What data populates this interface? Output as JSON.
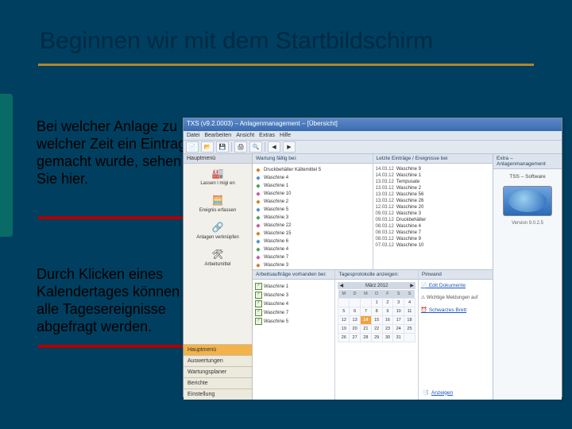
{
  "slide": {
    "title": "Beginnen wir mit dem Startbildschirm",
    "para1": "Bei welcher Anlage zu welcher Zeit ein Eintrag gemacht wurde, sehen Sie hier.",
    "para2": "Durch Klicken eines Kalendertages können alle Tagesereignisse abgefragt werden."
  },
  "window": {
    "title": "TXS (v9.2.0003) – Anlagenmanagement – [Übersicht]",
    "menubar": [
      "Datei",
      "Bearbeiten",
      "Ansicht",
      "Extras",
      "Hilfe"
    ]
  },
  "sidebar": {
    "header": "Hauptmenü",
    "items": [
      {
        "icon": "🏭",
        "label": "Lassen l migi en"
      },
      {
        "icon": "🧮",
        "label": "Ereignis erfassen"
      },
      {
        "icon": "🔗",
        "label": "Anlagen verknüpfen"
      },
      {
        "icon": "🛠",
        "label": "Arbeitsmittel"
      }
    ],
    "tabs": [
      "Hauptmenü",
      "Auswertungen",
      "Wartungsplaner",
      "Berichte",
      "Einstellung"
    ]
  },
  "panels": {
    "wartung": {
      "title": "Wartung fällig bei:",
      "items": [
        {
          "iconColor": "#d08030",
          "label": "Druckbehälter Kältemittel 5"
        },
        {
          "iconColor": "#5a8acc",
          "label": "Waschine 4"
        },
        {
          "iconColor": "#4aa050",
          "label": "Waschine 1"
        },
        {
          "iconColor": "#c85a9a",
          "label": "Waschine 10"
        },
        {
          "iconColor": "#d08030",
          "label": "Waschine 2"
        },
        {
          "iconColor": "#5a8acc",
          "label": "Waschine 5"
        },
        {
          "iconColor": "#4aa050",
          "label": "Waschine 3"
        },
        {
          "iconColor": "#c85a9a",
          "label": "Waschine 22"
        },
        {
          "iconColor": "#d08030",
          "label": "Waschine 15"
        },
        {
          "iconColor": "#5a8acc",
          "label": "Waschine 6"
        },
        {
          "iconColor": "#4aa050",
          "label": "Waschine 4"
        },
        {
          "iconColor": "#c85a9a",
          "label": "Waschine 7"
        },
        {
          "iconColor": "#d08030",
          "label": "Waschine 3"
        }
      ]
    },
    "eintraege": {
      "title": "Letzte Einträge / Ereignisse bei",
      "items": [
        {
          "ts": "14.03.12",
          "label": "Waschine 9"
        },
        {
          "ts": "14.03.12",
          "label": "Waschine 1"
        },
        {
          "ts": "13.03.12",
          "label": "Tempusate"
        },
        {
          "ts": "13.03.12",
          "label": "Waschine 2"
        },
        {
          "ts": "13.03.12",
          "label": "Waschine 56"
        },
        {
          "ts": "13.03.12",
          "label": "Waschine 26"
        },
        {
          "ts": "12.03.12",
          "label": "Waschine 20"
        },
        {
          "ts": "09.03.12",
          "label": "Waschine 3"
        },
        {
          "ts": "09.03.12",
          "label": "Druckbehälter"
        },
        {
          "ts": "08.03.12",
          "label": "Waschine 4"
        },
        {
          "ts": "08.03.12",
          "label": "Waschine 7"
        },
        {
          "ts": "08.03.12",
          "label": "Waschine 9"
        },
        {
          "ts": "07.03.12",
          "label": "Waschine 10"
        }
      ]
    },
    "arbeits": {
      "title": "Arbeitsaufträge vorhanden bei:",
      "items": [
        "Waschine 1",
        "Waschine 3",
        "Waschine 4",
        "Waschine 7",
        "Waschine 5"
      ]
    },
    "tages": {
      "title": "Tagesprotokolle anzeigen:",
      "month": "März 2012",
      "weekdays": [
        "M",
        "D",
        "M",
        "D",
        "F",
        "S",
        "S"
      ],
      "weeks": [
        [
          "",
          "",
          "",
          "1",
          "2",
          "3",
          "4"
        ],
        [
          "5",
          "6",
          "7",
          "8",
          "9",
          "10",
          "11"
        ],
        [
          "12",
          "13",
          "14",
          "15",
          "16",
          "17",
          "18"
        ],
        [
          "19",
          "20",
          "21",
          "22",
          "23",
          "24",
          "25"
        ],
        [
          "26",
          "27",
          "28",
          "29",
          "30",
          "31",
          ""
        ]
      ],
      "today": "14"
    },
    "pinwand": {
      "title": "Pinwand",
      "items": [
        {
          "icon": "📄",
          "label": "Edit Dokumente"
        },
        {
          "icon": "⚠",
          "label": "Wichtige Meldungen auf"
        },
        {
          "icon": "⏰",
          "label": "Schwarzes Brett"
        }
      ],
      "action": {
        "icon": "📑",
        "label": "Anzeigen"
      }
    }
  },
  "rightbar": {
    "header": "Extra – Anlagenmanagement",
    "brand1": "TSS – Software",
    "version": "Version 9.0.2.5"
  }
}
